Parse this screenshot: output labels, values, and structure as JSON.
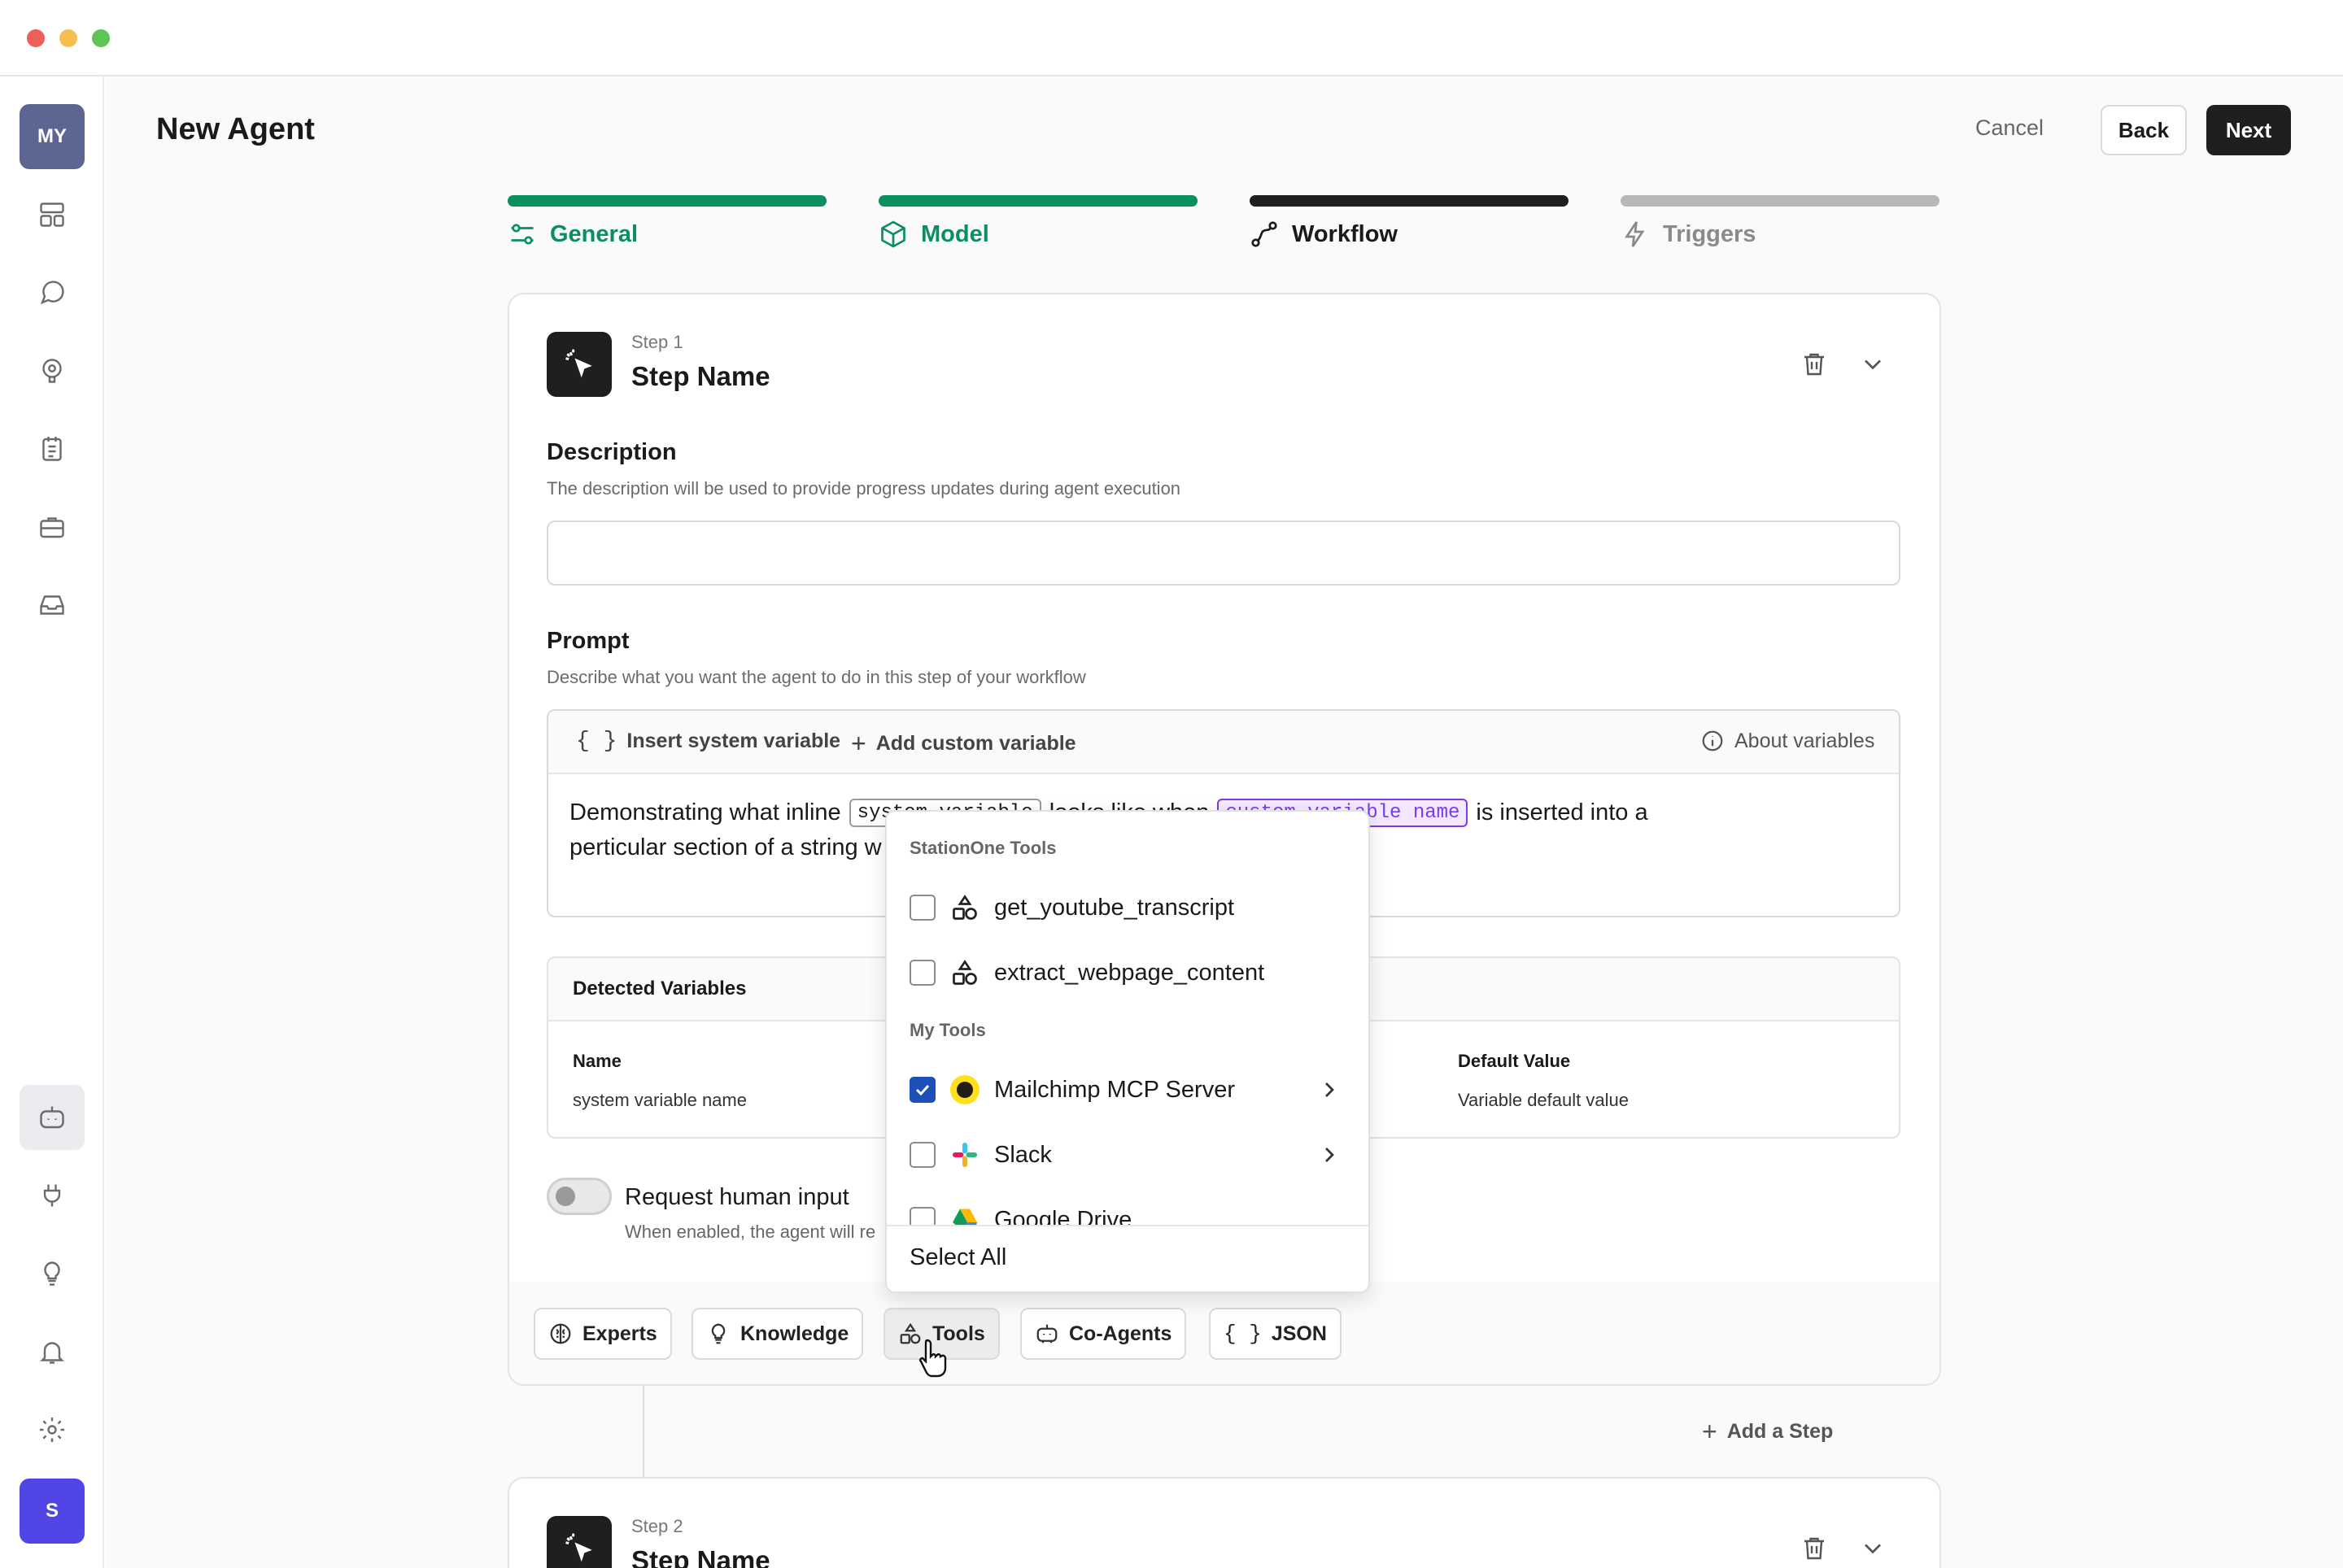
{
  "app": {
    "avatar_initials": "MY",
    "user_initial": "S"
  },
  "header": {
    "title": "New Agent",
    "cancel": "Cancel",
    "back": "Back",
    "next": "Next"
  },
  "stepper": [
    {
      "label": "General",
      "state": "complete"
    },
    {
      "label": "Model",
      "state": "complete"
    },
    {
      "label": "Workflow",
      "state": "current"
    },
    {
      "label": "Triggers",
      "state": "upcoming"
    }
  ],
  "step1": {
    "step_label": "Step 1",
    "name": "Step Name",
    "description": {
      "label": "Description",
      "help": "The description will be used to provide progress updates during agent execution",
      "value": ""
    },
    "prompt": {
      "label": "Prompt",
      "help": "Describe what you want the agent to do in this step of your workflow",
      "insert_system_variable": "Insert system variable",
      "add_custom_variable": "Add custom variable",
      "about_variables": "About variables",
      "text_1": "Demonstrating what inline",
      "chip_system": "system variable",
      "text_2": "looks like when",
      "chip_custom": "custom variable name",
      "text_3": "is inserted into a",
      "text_4": "perticular section of a string w"
    },
    "detected_variables": {
      "title": "Detected Variables",
      "col_name": "Name",
      "col_default": "Default Value",
      "row_name": "system variable name",
      "row_default": "Variable default value"
    },
    "human_input": {
      "label": "Request human input",
      "help": "When enabled, the agent will re",
      "enabled": false
    },
    "toolbar": [
      "Experts",
      "Knowledge",
      "Tools",
      "Co-Agents",
      "JSON"
    ]
  },
  "dropdown": {
    "group_1": "StationOne Tools",
    "group_1_items": [
      {
        "label": "get_youtube_transcript",
        "checked": false
      },
      {
        "label": "extract_webpage_content",
        "checked": false
      }
    ],
    "group_2": "My Tools",
    "group_2_items": [
      {
        "label": "Mailchimp MCP Server",
        "checked": true
      },
      {
        "label": "Slack",
        "checked": false
      },
      {
        "label": "Google Drive",
        "checked": false
      }
    ],
    "select_all": "Select All"
  },
  "add_step": "Add a Step",
  "step2": {
    "step_label": "Step 2",
    "name": "Step Name"
  },
  "colors": {
    "accent_green": "#0a8f5e",
    "primary_dark": "#1f1f1f",
    "checkbox_blue": "#1d4fb8",
    "custom_chip": "#7c3aed",
    "avatar_gray": "#5d6593",
    "avatar_purple": "#4f46e5"
  }
}
